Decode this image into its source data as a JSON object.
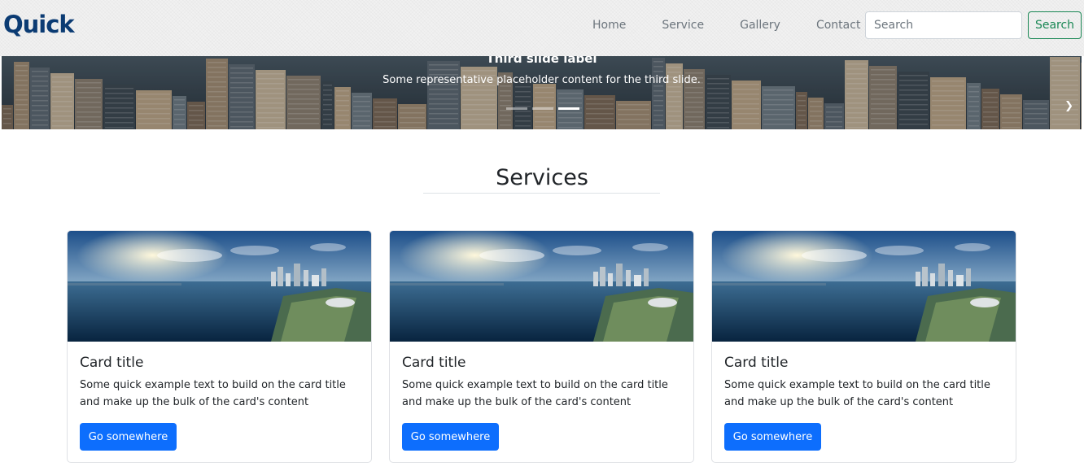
{
  "brand": {
    "name": "Quick"
  },
  "nav": {
    "links": [
      "Home",
      "Service",
      "Gallery",
      "Contact"
    ],
    "search_placeholder": "Search",
    "search_button": "Search"
  },
  "carousel": {
    "caption_title": "Third slide label",
    "caption_text": "Some representative placeholder content for the third slide.",
    "slide_count": 3,
    "active_slide": 3
  },
  "services": {
    "title": "Services",
    "cards": [
      {
        "title": "Card title",
        "text": "Some quick example text to build on the card title and make up the bulk of the card's content",
        "button": "Go somewhere"
      },
      {
        "title": "Card title",
        "text": "Some quick example text to build on the card title and make up the bulk of the card's content",
        "button": "Go somewhere"
      },
      {
        "title": "Card title",
        "text": "Some quick example text to build on the card title and make up the bulk of the card's content",
        "button": "Go somewhere"
      }
    ]
  },
  "colors": {
    "brand": "#0b3b73",
    "primary": "#0d6efd",
    "success": "#198754",
    "navbar_bg": "#f1f1f1"
  },
  "icons": {
    "carousel_next": "chevron-right-icon"
  }
}
